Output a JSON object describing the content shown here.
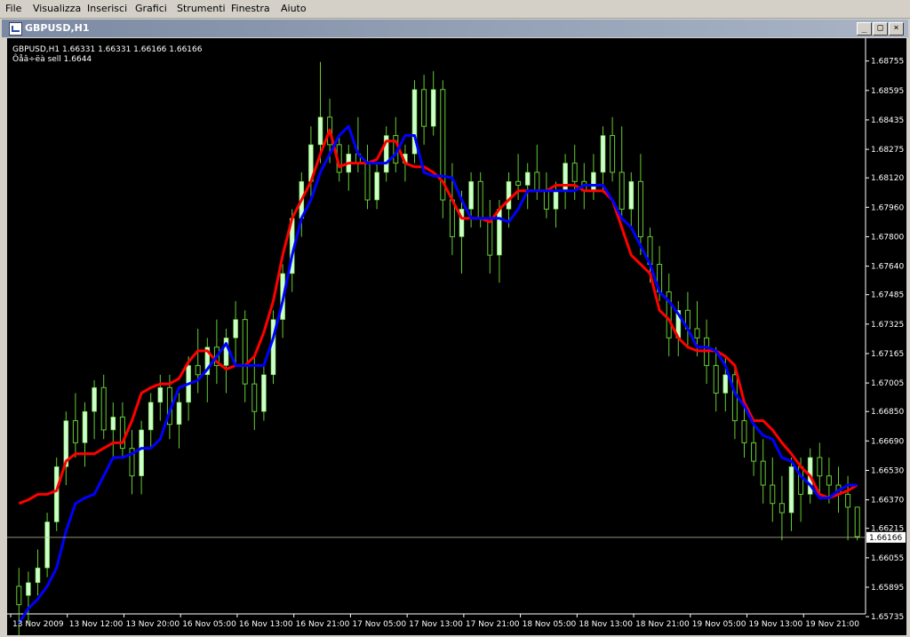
{
  "menu": [
    "File",
    "Visualizza",
    "Inserisci",
    "Grafici",
    "Strumenti",
    "Finestra",
    "Aiuto"
  ],
  "window": {
    "title": "GBPUSD,H1",
    "minimize_glyph": "_",
    "restore_glyph": "□",
    "close_glyph": "×"
  },
  "chart_header": {
    "ohlc_line": "GBPUSD,H1  1.66331 1.66331 1.66166 1.66166",
    "signal_line": "Ôåâ÷ëà sell 1.6644"
  },
  "colors": {
    "background": "#000000",
    "candle_up": "#ccffcc",
    "wick": "#66cc33",
    "red_line": "#ff0000",
    "blue_line": "#0000ff",
    "price_line": "#c0c0a0",
    "axis_text": "#ffffff"
  },
  "chart_data": {
    "type": "candlestick",
    "symbol": "GBPUSD",
    "timeframe": "H1",
    "ylim": [
      1.6575,
      1.6885
    ],
    "y_ticks": [
      "1.68755",
      "1.68595",
      "1.68435",
      "1.68275",
      "1.68120",
      "1.67960",
      "1.67800",
      "1.67640",
      "1.67485",
      "1.67325",
      "1.67165",
      "1.67005",
      "1.66850",
      "1.66690",
      "1.66530",
      "1.66370",
      "1.66215",
      "1.66055",
      "1.65895",
      "1.65735"
    ],
    "x_ticks": [
      "13 Nov 2009",
      "13 Nov 12:00",
      "13 Nov 20:00",
      "16 Nov 05:00",
      "16 Nov 13:00",
      "16 Nov 21:00",
      "17 Nov 05:00",
      "17 Nov 13:00",
      "17 Nov 21:00",
      "18 Nov 05:00",
      "18 Nov 13:00",
      "18 Nov 21:00",
      "19 Nov 05:00",
      "19 Nov 13:00",
      "19 Nov 21:00"
    ],
    "current_price": "1.66166",
    "candles": [
      [
        1.659,
        1.66,
        1.656,
        1.658
      ],
      [
        1.6585,
        1.6598,
        1.657,
        1.6592
      ],
      [
        1.6592,
        1.661,
        1.6585,
        1.66
      ],
      [
        1.66,
        1.663,
        1.6595,
        1.6625
      ],
      [
        1.6625,
        1.666,
        1.662,
        1.6655
      ],
      [
        1.6655,
        1.6685,
        1.6645,
        1.668
      ],
      [
        1.668,
        1.6695,
        1.666,
        1.6668
      ],
      [
        1.6668,
        1.669,
        1.6655,
        1.6685
      ],
      [
        1.6685,
        1.6702,
        1.667,
        1.6698
      ],
      [
        1.6698,
        1.6705,
        1.667,
        1.6675
      ],
      [
        1.6675,
        1.669,
        1.666,
        1.6682
      ],
      [
        1.6682,
        1.669,
        1.666,
        1.6665
      ],
      [
        1.6665,
        1.6675,
        1.664,
        1.665
      ],
      [
        1.665,
        1.668,
        1.664,
        1.6675
      ],
      [
        1.6675,
        1.6695,
        1.6665,
        1.669
      ],
      [
        1.669,
        1.6705,
        1.668,
        1.6698
      ],
      [
        1.6698,
        1.6705,
        1.667,
        1.6678
      ],
      [
        1.6678,
        1.6695,
        1.6665,
        1.669
      ],
      [
        1.669,
        1.6715,
        1.668,
        1.671
      ],
      [
        1.671,
        1.673,
        1.6695,
        1.6705
      ],
      [
        1.6705,
        1.6725,
        1.669,
        1.672
      ],
      [
        1.672,
        1.6735,
        1.67,
        1.671
      ],
      [
        1.671,
        1.673,
        1.6695,
        1.6725
      ],
      [
        1.6725,
        1.6745,
        1.671,
        1.6735
      ],
      [
        1.6735,
        1.674,
        1.669,
        1.67
      ],
      [
        1.67,
        1.6715,
        1.6675,
        1.6685
      ],
      [
        1.6685,
        1.671,
        1.668,
        1.6705
      ],
      [
        1.6705,
        1.674,
        1.67,
        1.6735
      ],
      [
        1.6735,
        1.6765,
        1.6725,
        1.676
      ],
      [
        1.676,
        1.6795,
        1.675,
        1.679
      ],
      [
        1.679,
        1.6815,
        1.678,
        1.681
      ],
      [
        1.681,
        1.684,
        1.68,
        1.683
      ],
      [
        1.683,
        1.6875,
        1.682,
        1.6845
      ],
      [
        1.6845,
        1.6855,
        1.682,
        1.683
      ],
      [
        1.683,
        1.6835,
        1.681,
        1.6815
      ],
      [
        1.6815,
        1.683,
        1.6805,
        1.6825
      ],
      [
        1.6825,
        1.6845,
        1.6815,
        1.682
      ],
      [
        1.682,
        1.683,
        1.6795,
        1.68
      ],
      [
        1.68,
        1.682,
        1.6795,
        1.6815
      ],
      [
        1.6815,
        1.684,
        1.681,
        1.6835
      ],
      [
        1.6835,
        1.6845,
        1.6815,
        1.682
      ],
      [
        1.682,
        1.683,
        1.681,
        1.6825
      ],
      [
        1.6825,
        1.6865,
        1.682,
        1.686
      ],
      [
        1.686,
        1.6868,
        1.683,
        1.684
      ],
      [
        1.684,
        1.687,
        1.6835,
        1.686
      ],
      [
        1.686,
        1.6865,
        1.679,
        1.68
      ],
      [
        1.68,
        1.682,
        1.677,
        1.678
      ],
      [
        1.678,
        1.6805,
        1.676,
        1.6795
      ],
      [
        1.6795,
        1.6815,
        1.6785,
        1.681
      ],
      [
        1.681,
        1.6815,
        1.6785,
        1.679
      ],
      [
        1.679,
        1.68,
        1.676,
        1.677
      ],
      [
        1.677,
        1.68,
        1.6755,
        1.6795
      ],
      [
        1.6795,
        1.6815,
        1.6785,
        1.681
      ],
      [
        1.681,
        1.6825,
        1.68,
        1.6808
      ],
      [
        1.6808,
        1.682,
        1.6795,
        1.6815
      ],
      [
        1.6815,
        1.683,
        1.68,
        1.6805
      ],
      [
        1.6805,
        1.6815,
        1.679,
        1.6795
      ],
      [
        1.6795,
        1.681,
        1.6785,
        1.6805
      ],
      [
        1.6805,
        1.6825,
        1.6795,
        1.682
      ],
      [
        1.682,
        1.683,
        1.68,
        1.681
      ],
      [
        1.681,
        1.682,
        1.6795,
        1.6805
      ],
      [
        1.6805,
        1.6825,
        1.68,
        1.6815
      ],
      [
        1.6815,
        1.684,
        1.6805,
        1.6835
      ],
      [
        1.6835,
        1.6845,
        1.681,
        1.6815
      ],
      [
        1.6815,
        1.684,
        1.679,
        1.6795
      ],
      [
        1.6795,
        1.6815,
        1.6785,
        1.681
      ],
      [
        1.681,
        1.6825,
        1.677,
        1.678
      ],
      [
        1.678,
        1.6785,
        1.6755,
        1.6765
      ],
      [
        1.6765,
        1.6775,
        1.6745,
        1.675
      ],
      [
        1.675,
        1.676,
        1.6715,
        1.6725
      ],
      [
        1.6725,
        1.6745,
        1.6715,
        1.674
      ],
      [
        1.674,
        1.675,
        1.672,
        1.673
      ],
      [
        1.673,
        1.6745,
        1.6715,
        1.6725
      ],
      [
        1.6725,
        1.6735,
        1.67,
        1.671
      ],
      [
        1.671,
        1.672,
        1.6685,
        1.6695
      ],
      [
        1.6695,
        1.6715,
        1.6685,
        1.6705
      ],
      [
        1.6705,
        1.671,
        1.667,
        1.668
      ],
      [
        1.668,
        1.669,
        1.666,
        1.6668
      ],
      [
        1.6668,
        1.668,
        1.665,
        1.6658
      ],
      [
        1.6658,
        1.667,
        1.6635,
        1.6645
      ],
      [
        1.6645,
        1.666,
        1.6625,
        1.6635
      ],
      [
        1.6635,
        1.665,
        1.6615,
        1.663
      ],
      [
        1.663,
        1.666,
        1.662,
        1.6655
      ],
      [
        1.6655,
        1.666,
        1.6625,
        1.664
      ],
      [
        1.664,
        1.6665,
        1.6635,
        1.666
      ],
      [
        1.666,
        1.6668,
        1.664,
        1.665
      ],
      [
        1.665,
        1.666,
        1.6635,
        1.6645
      ],
      [
        1.6645,
        1.6655,
        1.663,
        1.664
      ],
      [
        1.664,
        1.665,
        1.6615,
        1.6633
      ],
      [
        1.6633,
        1.6633,
        1.6615,
        1.6617
      ]
    ],
    "series": [
      {
        "color": "red",
        "values": [
          1.6635,
          1.6637,
          1.664,
          1.664,
          1.6642,
          1.6658,
          1.6662,
          1.6662,
          1.6662,
          1.6665,
          1.6668,
          1.6668,
          1.668,
          1.6695,
          1.6698,
          1.67,
          1.67,
          1.6703,
          1.6712,
          1.6718,
          1.6718,
          1.6712,
          1.6708,
          1.671,
          1.671,
          1.6715,
          1.6728,
          1.6745,
          1.677,
          1.679,
          1.68,
          1.681,
          1.6825,
          1.6838,
          1.6818,
          1.682,
          1.682,
          1.682,
          1.6822,
          1.6832,
          1.6832,
          1.682,
          1.6818,
          1.6818,
          1.6815,
          1.681,
          1.68,
          1.679,
          1.679,
          1.679,
          1.6788,
          1.6795,
          1.68,
          1.6805,
          1.6805,
          1.6805,
          1.6805,
          1.6808,
          1.6808,
          1.6808,
          1.6805,
          1.6805,
          1.6805,
          1.68,
          1.6785,
          1.677,
          1.6765,
          1.676,
          1.674,
          1.6735,
          1.6725,
          1.672,
          1.6718,
          1.6718,
          1.6718,
          1.6715,
          1.671,
          1.669,
          1.668,
          1.668,
          1.6675,
          1.6668,
          1.6662,
          1.6655,
          1.665,
          1.664,
          1.6638,
          1.664,
          1.6642,
          1.6645
        ]
      },
      {
        "color": "blue",
        "values": [
          1.657,
          1.6578,
          1.6583,
          1.659,
          1.66,
          1.662,
          1.6635,
          1.6638,
          1.664,
          1.665,
          1.666,
          1.666,
          1.6662,
          1.6665,
          1.6665,
          1.667,
          1.6685,
          1.6698,
          1.67,
          1.6702,
          1.6708,
          1.6715,
          1.6722,
          1.671,
          1.671,
          1.671,
          1.671,
          1.6725,
          1.6745,
          1.677,
          1.679,
          1.68,
          1.6815,
          1.6825,
          1.6835,
          1.684,
          1.6825,
          1.682,
          1.682,
          1.682,
          1.6825,
          1.6835,
          1.6835,
          1.6815,
          1.6813,
          1.6813,
          1.6812,
          1.68,
          1.679,
          1.679,
          1.679,
          1.679,
          1.6788,
          1.6795,
          1.6805,
          1.6805,
          1.6805,
          1.6805,
          1.6805,
          1.6805,
          1.6808,
          1.6808,
          1.6808,
          1.68,
          1.679,
          1.6785,
          1.6775,
          1.6765,
          1.675,
          1.6745,
          1.6738,
          1.673,
          1.672,
          1.672,
          1.6718,
          1.671,
          1.6695,
          1.6688,
          1.6678,
          1.6672,
          1.667,
          1.666,
          1.6658,
          1.665,
          1.6645,
          1.6638,
          1.6638,
          1.6642,
          1.6645,
          1.6645
        ]
      }
    ]
  }
}
